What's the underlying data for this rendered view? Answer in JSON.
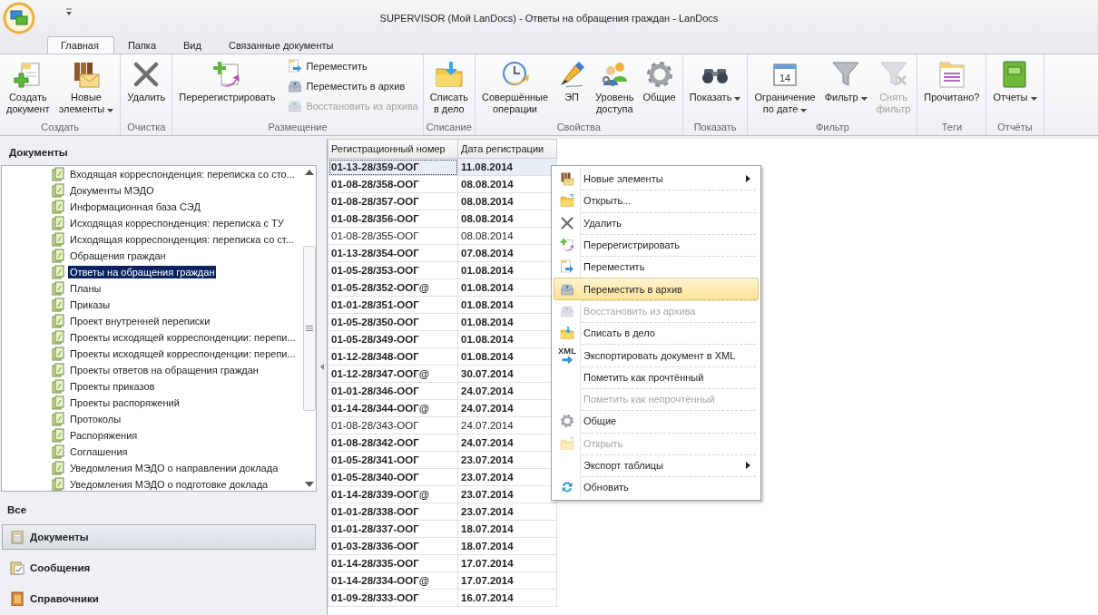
{
  "window": {
    "title": "SUPERVISOR (Мой LanDocs) - Ответы на обращения граждан - LanDocs"
  },
  "tabs": [
    {
      "label": "Главная",
      "selected": true
    },
    {
      "label": "Папка",
      "selected": false
    },
    {
      "label": "Вид",
      "selected": false
    },
    {
      "label": "Связанные документы",
      "selected": false
    }
  ],
  "ribbon": [
    {
      "label": "Создать",
      "items": [
        {
          "kind": "large",
          "label": "Создать\nдокумент",
          "disabled": false,
          "dropdown": false
        },
        {
          "kind": "large",
          "label": "Новые\nэлементы",
          "disabled": false,
          "dropdown": true
        }
      ]
    },
    {
      "label": "Очистка",
      "items": [
        {
          "kind": "large",
          "label": "Удалить",
          "disabled": false,
          "dropdown": false
        }
      ]
    },
    {
      "label": "Размещение",
      "items": [
        {
          "kind": "large",
          "label": "Перерегистрировать",
          "disabled": false,
          "dropdown": false
        },
        {
          "kind": "small",
          "label": "Переместить",
          "disabled": false,
          "dropdown": false
        },
        {
          "kind": "small",
          "label": "Переместить в архив",
          "disabled": false,
          "dropdown": false
        },
        {
          "kind": "small",
          "label": "Восстановить из архива",
          "disabled": true,
          "dropdown": false
        }
      ]
    },
    {
      "label": "Списание",
      "items": [
        {
          "kind": "large",
          "label": "Списать\nв дело",
          "disabled": false,
          "dropdown": false
        }
      ]
    },
    {
      "label": "Свойства",
      "items": [
        {
          "kind": "large",
          "label": "Совершённые\nоперации",
          "disabled": false,
          "dropdown": false
        },
        {
          "kind": "large",
          "label": "ЭП",
          "disabled": false,
          "dropdown": false
        },
        {
          "kind": "large",
          "label": "Уровень\nдоступа",
          "disabled": false,
          "dropdown": false
        },
        {
          "kind": "large",
          "label": "Общие",
          "disabled": false,
          "dropdown": false
        }
      ]
    },
    {
      "label": "Показать",
      "items": [
        {
          "kind": "large",
          "label": "Показать",
          "disabled": false,
          "dropdown": true
        }
      ]
    },
    {
      "label": "Фильтр",
      "items": [
        {
          "kind": "large",
          "label": "Ограничение\nпо дате",
          "disabled": false,
          "dropdown": true,
          "icon_text": "14"
        },
        {
          "kind": "large",
          "label": "Фильтр",
          "disabled": false,
          "dropdown": true
        },
        {
          "kind": "large",
          "label": "Снять\nфильтр",
          "disabled": true,
          "dropdown": false
        }
      ]
    },
    {
      "label": "Теги",
      "items": [
        {
          "kind": "large",
          "label": "Прочитано?",
          "disabled": false,
          "dropdown": false
        }
      ]
    },
    {
      "label": "Отчёты",
      "items": [
        {
          "kind": "large",
          "label": "Отчеты",
          "disabled": false,
          "dropdown": true
        }
      ]
    }
  ],
  "sidebar": {
    "title": "Документы",
    "tree": [
      {
        "label": "Входящая корреспонденция: переписка со сто...",
        "selected": false
      },
      {
        "label": "Документы МЭДО",
        "selected": false
      },
      {
        "label": "Информационная база СЭД",
        "selected": false
      },
      {
        "label": "Исходящая корреспонденция: переписка с ТУ",
        "selected": false
      },
      {
        "label": "Исходящая корреспонденция: переписка со ст...",
        "selected": false
      },
      {
        "label": "Обращения граждан",
        "selected": false
      },
      {
        "label": "Ответы на обращения граждан",
        "selected": true
      },
      {
        "label": "Планы",
        "selected": false
      },
      {
        "label": "Приказы",
        "selected": false
      },
      {
        "label": "Проект внутренней переписки",
        "selected": false
      },
      {
        "label": "Проекты исходящей корреспонденции: перепи...",
        "selected": false
      },
      {
        "label": "Проекты исходящей корреспонденции: перепи...",
        "selected": false
      },
      {
        "label": "Проекты ответов на обращения граждан",
        "selected": false
      },
      {
        "label": "Проекты приказов",
        "selected": false
      },
      {
        "label": "Проекты распоряжений",
        "selected": false
      },
      {
        "label": "Протоколы",
        "selected": false
      },
      {
        "label": "Распоряжения",
        "selected": false
      },
      {
        "label": "Соглашения",
        "selected": false
      },
      {
        "label": "Уведомления МЭДО о направлении доклада",
        "selected": false
      },
      {
        "label": "Уведомления МЭДО о подготовке доклада",
        "selected": false
      }
    ],
    "section": "Все",
    "nav": [
      {
        "label": "Документы",
        "selected": true
      },
      {
        "label": "Сообщения",
        "selected": false
      },
      {
        "label": "Справочники",
        "selected": false
      }
    ]
  },
  "table": {
    "columns": [
      "Регистрационный номер",
      "Дата регистрации"
    ],
    "rows": [
      {
        "cells": [
          "01-13-28/359-ООГ",
          "11.08.2014"
        ],
        "unread": true,
        "selected": true
      },
      {
        "cells": [
          "01-08-28/358-ООГ",
          "08.08.2014"
        ],
        "unread": true,
        "selected": false
      },
      {
        "cells": [
          "01-08-28/357-ООГ",
          "08.08.2014"
        ],
        "unread": true,
        "selected": false
      },
      {
        "cells": [
          "01-08-28/356-ООГ",
          "08.08.2014"
        ],
        "unread": true,
        "selected": false
      },
      {
        "cells": [
          "01-08-28/355-ООГ",
          "08.08.2014"
        ],
        "unread": false,
        "selected": false
      },
      {
        "cells": [
          "01-13-28/354-ООГ",
          "07.08.2014"
        ],
        "unread": true,
        "selected": false
      },
      {
        "cells": [
          "01-05-28/353-ООГ",
          "01.08.2014"
        ],
        "unread": true,
        "selected": false
      },
      {
        "cells": [
          "01-05-28/352-ООГ@",
          "01.08.2014"
        ],
        "unread": true,
        "selected": false
      },
      {
        "cells": [
          "01-01-28/351-ООГ",
          "01.08.2014"
        ],
        "unread": true,
        "selected": false
      },
      {
        "cells": [
          "01-05-28/350-ООГ",
          "01.08.2014"
        ],
        "unread": true,
        "selected": false
      },
      {
        "cells": [
          "01-05-28/349-ООГ",
          "01.08.2014"
        ],
        "unread": true,
        "selected": false
      },
      {
        "cells": [
          "01-12-28/348-ООГ",
          "01.08.2014"
        ],
        "unread": true,
        "selected": false
      },
      {
        "cells": [
          "01-12-28/347-ООГ@",
          "30.07.2014"
        ],
        "unread": true,
        "selected": false
      },
      {
        "cells": [
          "01-01-28/346-ООГ",
          "24.07.2014"
        ],
        "unread": true,
        "selected": false
      },
      {
        "cells": [
          "01-14-28/344-ООГ@",
          "24.07.2014"
        ],
        "unread": true,
        "selected": false
      },
      {
        "cells": [
          "01-08-28/343-ООГ",
          "24.07.2014"
        ],
        "unread": false,
        "selected": false
      },
      {
        "cells": [
          "01-08-28/342-ООГ",
          "24.07.2014"
        ],
        "unread": true,
        "selected": false
      },
      {
        "cells": [
          "01-05-28/341-ООГ",
          "23.07.2014"
        ],
        "unread": true,
        "selected": false
      },
      {
        "cells": [
          "01-05-28/340-ООГ",
          "23.07.2014"
        ],
        "unread": true,
        "selected": false
      },
      {
        "cells": [
          "01-14-28/339-ООГ@",
          "23.07.2014"
        ],
        "unread": true,
        "selected": false
      },
      {
        "cells": [
          "01-01-28/338-ООГ",
          "23.07.2014"
        ],
        "unread": true,
        "selected": false
      },
      {
        "cells": [
          "01-01-28/337-ООГ",
          "18.07.2014"
        ],
        "unread": true,
        "selected": false
      },
      {
        "cells": [
          "01-03-28/336-ООГ",
          "18.07.2014"
        ],
        "unread": true,
        "selected": false
      },
      {
        "cells": [
          "01-14-28/335-ООГ",
          "17.07.2014"
        ],
        "unread": true,
        "selected": false
      },
      {
        "cells": [
          "01-14-28/334-ООГ@",
          "17.07.2014"
        ],
        "unread": true,
        "selected": false
      },
      {
        "cells": [
          "01-09-28/333-ООГ",
          "16.07.2014"
        ],
        "unread": true,
        "selected": false
      }
    ]
  },
  "context_menu": [
    {
      "label": "Новые элементы",
      "submenu": true,
      "disabled": false,
      "selected": false
    },
    {
      "label": "Открыть...",
      "submenu": false,
      "disabled": false,
      "selected": false
    },
    {
      "label": "Удалить",
      "submenu": false,
      "disabled": false,
      "selected": false
    },
    {
      "label": "Перерегистрировать",
      "submenu": false,
      "disabled": false,
      "selected": false
    },
    {
      "label": "Переместить",
      "submenu": false,
      "disabled": false,
      "selected": false
    },
    {
      "label": "Переместить в архив",
      "submenu": false,
      "disabled": false,
      "selected": true
    },
    {
      "label": "Восстановить из архива",
      "submenu": false,
      "disabled": true,
      "selected": false
    },
    {
      "label": "Списать в дело",
      "submenu": false,
      "disabled": false,
      "selected": false
    },
    {
      "label": "Экспортировать документ в XML",
      "submenu": false,
      "disabled": false,
      "selected": false,
      "icon_text": "XML"
    },
    {
      "label": "Пометить как прочтённый",
      "submenu": false,
      "disabled": false,
      "selected": false
    },
    {
      "label": "Пометить как непрочтённый",
      "submenu": false,
      "disabled": true,
      "selected": false
    },
    {
      "label": "Общие",
      "submenu": false,
      "disabled": false,
      "selected": false
    },
    {
      "label": "Открыть",
      "submenu": false,
      "disabled": true,
      "selected": false
    },
    {
      "label": "Экспорт таблицы",
      "submenu": true,
      "disabled": false,
      "selected": false
    },
    {
      "label": "Обновить",
      "submenu": false,
      "disabled": false,
      "selected": false
    }
  ]
}
